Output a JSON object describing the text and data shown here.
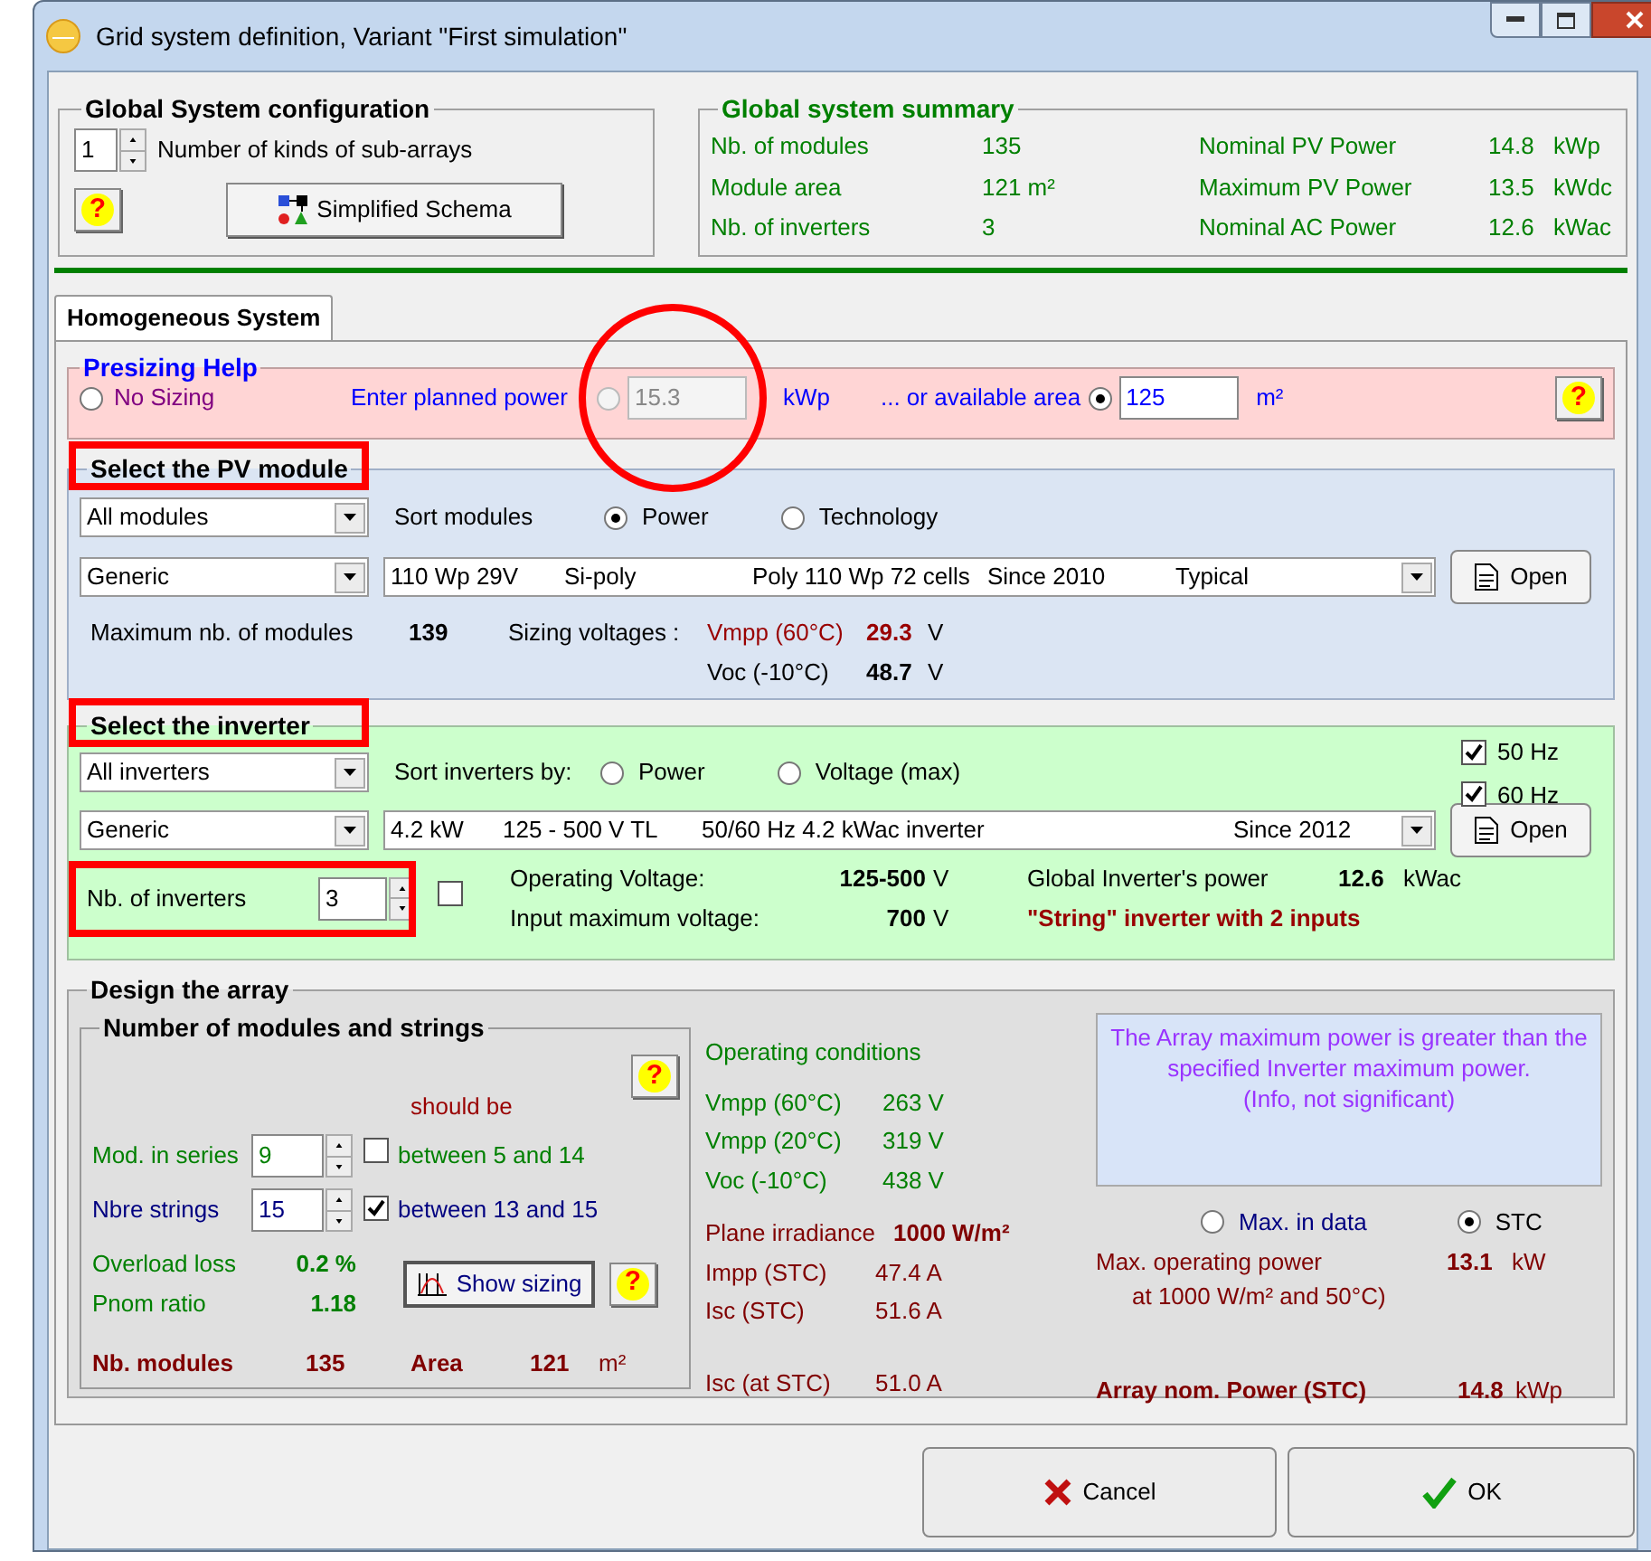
{
  "window": {
    "title": "Grid system definition, Variant  \"First simulation\""
  },
  "global_config": {
    "title": "Global System configuration",
    "sub_arrays": {
      "value": "1",
      "label": "Number of kinds of sub-arrays"
    },
    "help": "?",
    "schema_button": "Simplified Schema"
  },
  "summary": {
    "title": "Global system summary",
    "left": [
      {
        "label": "Nb. of modules",
        "value": "135"
      },
      {
        "label": "Module area",
        "value": "121 m²"
      },
      {
        "label": "Nb. of inverters",
        "value": "3"
      }
    ],
    "right": [
      {
        "label": "Nominal PV Power",
        "value": "14.8",
        "unit": "kWp"
      },
      {
        "label": "Maximum PV Power",
        "value": "13.5",
        "unit": "kWdc"
      },
      {
        "label": "Nominal AC Power",
        "value": "12.6",
        "unit": "kWac"
      }
    ]
  },
  "tabs": [
    {
      "label": "Homogeneous System",
      "selected": true
    }
  ],
  "presizing": {
    "title": "Presizing Help",
    "help": "?",
    "options": [
      {
        "kind": "plain",
        "label": "No Sizing",
        "selected": false
      },
      {
        "kind": "input",
        "label": "Enter planned power",
        "selected": false,
        "disabled": true,
        "annotated": true,
        "value": "15.3",
        "unit": "kWp"
      },
      {
        "kind": "input",
        "label": "... or available area",
        "selected": true,
        "disabled": false,
        "annotated": false,
        "value": "125",
        "unit": "m²"
      }
    ]
  },
  "pv_module": {
    "title": "Select the PV module",
    "annotated": true,
    "filter": "All modules",
    "sort_label": "Sort modules",
    "sort_options": [
      {
        "label": "Power",
        "selected": true
      },
      {
        "label": "Technology",
        "selected": false
      }
    ],
    "manufacturer": "Generic",
    "model": [
      "110 Wp 29V",
      "Si-poly",
      "Poly 110 Wp  72 cells",
      "Since 2010",
      "Typical"
    ],
    "open_button": "Open",
    "max_label": "Maximum nb. of modules",
    "max_value": "139",
    "sizing_label": "Sizing voltages :",
    "voltages": [
      {
        "label": "Vmpp (60°C)",
        "value": "29.3",
        "unit": "V",
        "warning": true
      },
      {
        "label": "Voc  (-10°C)",
        "value": "48.7",
        "unit": "V",
        "warning": false
      }
    ]
  },
  "inverter": {
    "title": "Select the inverter",
    "annotated": true,
    "frequencies": [
      {
        "label": "50 Hz",
        "checked": true
      },
      {
        "label": "60 Hz",
        "checked": true
      }
    ],
    "filter": "All inverters",
    "sort_label": "Sort inverters by:",
    "sort_options": [
      {
        "label": "Power",
        "selected": false
      },
      {
        "label": "Voltage (max)",
        "selected": false
      }
    ],
    "manufacturer": "Generic",
    "model": [
      "4.2 kW",
      "125 - 500 V  TL",
      "50/60 Hz  4.2 kWac inverter",
      "Since 2012"
    ],
    "open_button": "Open",
    "count": {
      "label": "Nb. of inverters",
      "value": "3",
      "annotated": true
    },
    "extra_checked": false,
    "operating_voltage": {
      "label": "Operating Voltage:",
      "value": "125-500",
      "unit": "V"
    },
    "max_voltage": {
      "label": "Input maximum voltage:",
      "value": "700",
      "unit": "V"
    },
    "global_power": {
      "label": "Global Inverter's power",
      "value": "12.6",
      "unit": "kWac"
    },
    "inverter_type": "\"String\" inverter with 2 inputs"
  },
  "design": {
    "title": "Design the array",
    "strings": {
      "title": "Number of modules and strings",
      "help": "?",
      "should_be": "should be",
      "rows": [
        {
          "label": "Mod. in series",
          "value": "9",
          "checked": false,
          "range": "between 5 and 14",
          "color": "#008000"
        },
        {
          "label": "Nbre strings",
          "value": "15",
          "checked": true,
          "range": "between 13 and 15",
          "color": "#000080"
        }
      ],
      "overload": {
        "label": "Overload loss",
        "value": "0.2 %"
      },
      "pnom": {
        "label": "Pnom ratio",
        "value": "1.18"
      },
      "show_sizing": "Show sizing",
      "help2": "?",
      "nb_modules": {
        "label": "Nb. modules",
        "value": "135"
      },
      "area": {
        "label": "Area",
        "value": "121",
        "unit": "m²"
      }
    },
    "operating": {
      "title": "Operating conditions",
      "voltages": [
        {
          "label": "Vmpp (60°C)",
          "value": "263 V"
        },
        {
          "label": "Vmpp (20°C)",
          "value": "319 V"
        },
        {
          "label": "Voc  (-10°C)",
          "value": "438 V"
        }
      ],
      "irradiance": {
        "label": "Plane irradiance",
        "value": "1000 W/m²"
      },
      "currents": [
        {
          "label": "Impp (STC)",
          "value": "47.4 A"
        },
        {
          "label": "Isc  (STC)",
          "value": "51.6 A"
        }
      ],
      "isc_at_stc": {
        "label": "Isc (at STC)",
        "value": "51.0 A"
      }
    },
    "message": "The Array maximum power is greater than the specified Inverter maximum power.",
    "message_note": "(Info, not significant)",
    "power_mode": [
      {
        "label": "Max. in data",
        "selected": false
      },
      {
        "label": "STC",
        "selected": true
      }
    ],
    "max_power": {
      "label": "Max. operating power",
      "sublabel": "at 1000 W/m² and 50°C)",
      "value": "13.1",
      "unit": "kW"
    },
    "array_power": {
      "label": "Array nom. Power (STC)",
      "value": "14.8",
      "unit": "kWp"
    }
  },
  "buttons": [
    {
      "label": "Cancel",
      "kind": "cancel"
    },
    {
      "label": "OK",
      "kind": "ok"
    }
  ]
}
